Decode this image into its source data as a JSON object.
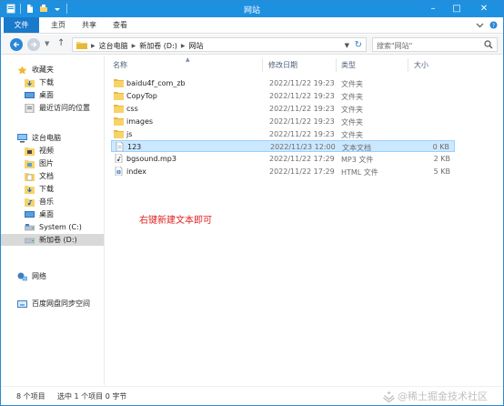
{
  "window": {
    "title": "网站"
  },
  "ribbon": {
    "tabs": [
      "文件",
      "主页",
      "共享",
      "查看"
    ]
  },
  "address": {
    "crumbs": [
      "这台电脑",
      "新加卷 (D:)",
      "网站"
    ],
    "search_placeholder": "搜索\"网站\""
  },
  "nav": {
    "favorites": {
      "label": "收藏夹",
      "items": [
        "下载",
        "桌面",
        "最近访问的位置"
      ]
    },
    "computer": {
      "label": "这台电脑",
      "items": [
        "视频",
        "图片",
        "文档",
        "下载",
        "音乐",
        "桌面",
        "System (C:)",
        "新加卷 (D:)"
      ]
    },
    "network": "网络",
    "baidu": "百度网盘同步空间"
  },
  "columns": {
    "name": "名称",
    "date": "修改日期",
    "type": "类型",
    "size": "大小"
  },
  "files": [
    {
      "name": "baidu4f_com_zb",
      "date": "2022/11/22 19:23",
      "type": "文件夹",
      "size": "",
      "icon": "folder-icon"
    },
    {
      "name": "CopyTop",
      "date": "2022/11/22 19:23",
      "type": "文件夹",
      "size": "",
      "icon": "folder-icon"
    },
    {
      "name": "css",
      "date": "2022/11/22 19:23",
      "type": "文件夹",
      "size": "",
      "icon": "folder-icon"
    },
    {
      "name": "images",
      "date": "2022/11/22 19:23",
      "type": "文件夹",
      "size": "",
      "icon": "folder-icon"
    },
    {
      "name": "js",
      "date": "2022/11/22 19:23",
      "type": "文件夹",
      "size": "",
      "icon": "folder-icon"
    },
    {
      "name": "123",
      "date": "2022/11/23 12:00",
      "type": "文本文档",
      "size": "0 KB",
      "icon": "text-file-icon"
    },
    {
      "name": "bgsound.mp3",
      "date": "2022/11/22 17:29",
      "type": "MP3 文件",
      "size": "2 KB",
      "icon": "audio-file-icon"
    },
    {
      "name": "index",
      "date": "2022/11/22 17:29",
      "type": "HTML 文件",
      "size": "5 KB",
      "icon": "html-file-icon"
    }
  ],
  "annotation": "右键新建文本即可",
  "status": {
    "count": "8 个项目",
    "selected": "选中 1 个项目 0 字节"
  },
  "watermark": "@稀土掘金技术社区",
  "colors": {
    "titlebar": "#1e90e0",
    "accent": "#1979ca",
    "folder": "#f7d36a",
    "selection": "#cce8ff",
    "annotation": "#e02020"
  }
}
